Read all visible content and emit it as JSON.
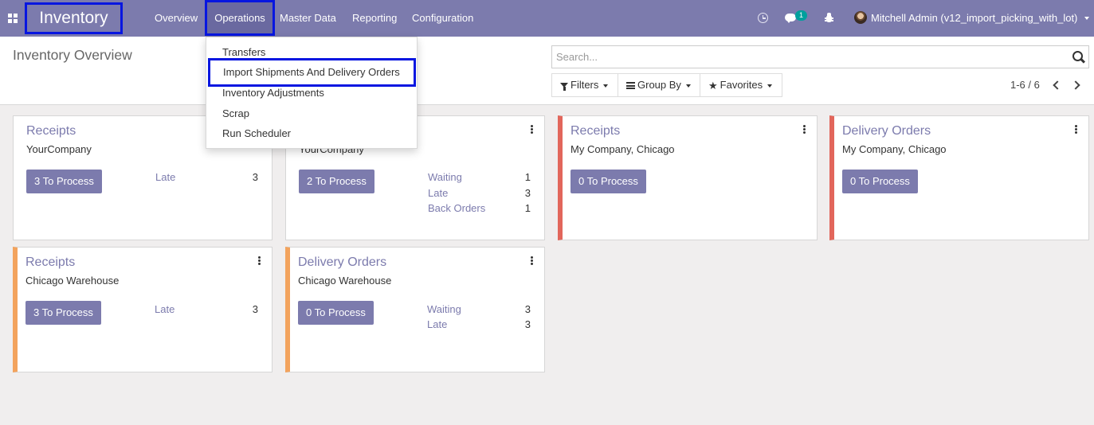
{
  "navbar": {
    "brand": "Inventory",
    "menu": [
      "Overview",
      "Operations",
      "Master Data",
      "Reporting",
      "Configuration"
    ],
    "chat_badge": "1",
    "user": "Mitchell Admin (v12_import_picking_with_lot)",
    "accent_color": "#7c7bad"
  },
  "operations_menu": {
    "items": [
      "Transfers",
      "Import Shipments And Delivery Orders",
      "Inventory Adjustments",
      "Scrap",
      "Run Scheduler"
    ]
  },
  "control_panel": {
    "title": "Inventory Overview",
    "search_placeholder": "Search...",
    "filters_label": "Filters",
    "group_by_label": "Group By",
    "favorites_label": "Favorites",
    "pager": "1-6 / 6"
  },
  "cards": [
    {
      "title": "Receipts",
      "subtitle": "YourCompany",
      "button": "3 To Process",
      "stats": [
        {
          "label": "Late",
          "value": "3"
        }
      ]
    },
    {
      "title": "",
      "subtitle": "YourCompany",
      "button": "2 To Process",
      "stats": [
        {
          "label": "Waiting",
          "value": "1"
        },
        {
          "label": "Late",
          "value": "3"
        },
        {
          "label": "Back Orders",
          "value": "1"
        }
      ]
    },
    {
      "title": "Receipts",
      "subtitle": "My Company, Chicago",
      "button": "0 To Process",
      "stats": []
    },
    {
      "title": "Delivery Orders",
      "subtitle": "My Company, Chicago",
      "button": "0 To Process",
      "stats": []
    },
    {
      "title": "Receipts",
      "subtitle": "Chicago Warehouse",
      "button": "3 To Process",
      "stats": [
        {
          "label": "Late",
          "value": "3"
        }
      ]
    },
    {
      "title": "Delivery Orders",
      "subtitle": "Chicago Warehouse",
      "button": "0 To Process",
      "stats": [
        {
          "label": "Waiting",
          "value": "3"
        },
        {
          "label": "Late",
          "value": "3"
        }
      ]
    }
  ],
  "colors": {
    "card_border_red": "#e2665b",
    "card_border_orange": "#f3a35d",
    "highlight_box": "#0716e0"
  }
}
